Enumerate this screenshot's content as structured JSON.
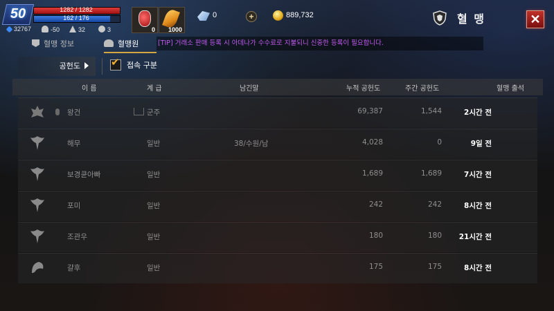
{
  "player": {
    "level": "50",
    "hp": "1282 / 1282",
    "mp": "162 / 176",
    "stats": [
      "32767",
      "-50",
      "32",
      "3"
    ]
  },
  "items": {
    "potion_count": "0",
    "feather_count": "1000"
  },
  "currency": {
    "gems": "0",
    "gold": "889,732",
    "plus_label": "+"
  },
  "header": {
    "title": "혈 맹",
    "close_label": "✕"
  },
  "tabs": [
    {
      "label": "혈맹 정보"
    },
    {
      "label": "혈맹원"
    }
  ],
  "tip": "[TIP] 거래소 판매 등록 시 아데나가 수수료로 지불되니 신중한 등록이 필요합니다.",
  "filter": {
    "sort_label": "공헌도",
    "checkbox_label": "접속 구분",
    "checked": true
  },
  "table": {
    "headers": [
      "이 름",
      "계 급",
      "남긴말",
      "누적 공헌도",
      "주간 공헌도",
      "혈맹 출석"
    ],
    "rows": [
      {
        "name": "왕건",
        "rank": "군주",
        "message": "",
        "total": "69,387",
        "weekly": "1,544",
        "attendance": "2시간 전"
      },
      {
        "name": "해무",
        "rank": "일반",
        "message": "38/수원/남",
        "total": "4,028",
        "weekly": "0",
        "attendance": "9일 전"
      },
      {
        "name": "보경큔아빠",
        "rank": "일반",
        "message": "",
        "total": "1,689",
        "weekly": "1,689",
        "attendance": "7시간 전"
      },
      {
        "name": "포미",
        "rank": "일반",
        "message": "",
        "total": "242",
        "weekly": "242",
        "attendance": "8시간 전"
      },
      {
        "name": "조관우",
        "rank": "일반",
        "message": "",
        "total": "180",
        "weekly": "180",
        "attendance": "21시간 전"
      },
      {
        "name": "걀후",
        "rank": "일반",
        "message": "",
        "total": "175",
        "weekly": "175",
        "attendance": "8시간 전"
      }
    ]
  },
  "colors": {
    "tip": "#c15af0",
    "accent_gold": "#d6a640",
    "close_red": "#c0302a"
  }
}
